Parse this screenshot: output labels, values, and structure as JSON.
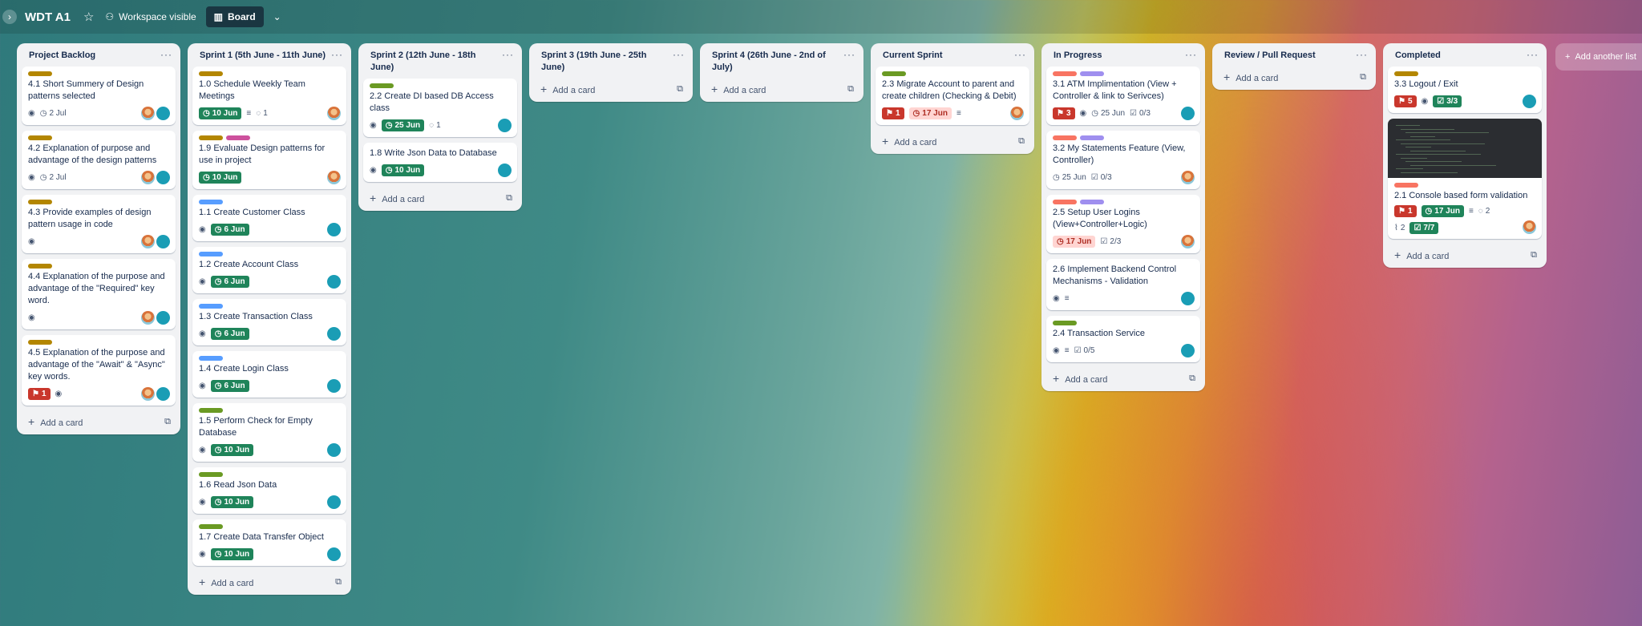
{
  "topbar": {
    "title": "WDT A1",
    "visibility": "Workspace visible",
    "view": "Board"
  },
  "colors": {
    "yellow": "#b38600",
    "orange": "#f87462",
    "purple": "#9f8fef",
    "green": "#5b7f24",
    "blue": "#579dff",
    "pink": "#cd519d",
    "lime": "#6a9a23"
  },
  "add_card": "Add a card",
  "add_list": "Add another list",
  "lists": [
    {
      "title": "Project Backlog",
      "cards": [
        {
          "labels": [
            "yellow"
          ],
          "title": "4.1 Short Summery of Design patterns selected",
          "eye": true,
          "date": "2 Jul",
          "avatars": [
            "ph",
            "kb"
          ]
        },
        {
          "labels": [
            "yellow"
          ],
          "title": "4.2 Explanation of purpose and advantage of the design patterns",
          "eye": true,
          "date": "2 Jul",
          "avatars": [
            "ph",
            "kb"
          ]
        },
        {
          "labels": [
            "yellow"
          ],
          "title": "4.3 Provide examples of design pattern usage in code",
          "eye": true,
          "avatars": [
            "ph",
            "kb"
          ]
        },
        {
          "labels": [
            "yellow"
          ],
          "title": "4.4 Explanation of the purpose and advantage of the \"Required\" key word.",
          "eye": true,
          "avatars": [
            "ph",
            "kb"
          ]
        },
        {
          "labels": [
            "yellow"
          ],
          "title": "4.5 Explanation of the purpose and advantage of the \"Await\" & \"Async\" key words.",
          "badge": "1",
          "eye": true,
          "avatars": [
            "ph",
            "kb"
          ]
        }
      ]
    },
    {
      "title": "Sprint 1 (5th June - 11th June)",
      "cards": [
        {
          "labels": [
            "yellow"
          ],
          "title": "1.0 Schedule Weekly Team Meetings",
          "due": "10 Jun",
          "desc": true,
          "comments": "1",
          "avatars": [
            "ph"
          ]
        },
        {
          "labels": [
            "yellow",
            "pink"
          ],
          "title": "1.9 Evaluate Design patterns for use in project",
          "due": "10 Jun",
          "avatars": [
            "ph"
          ]
        },
        {
          "labels": [
            "blue"
          ],
          "title": "1.1 Create Customer Class",
          "eye": true,
          "due": "6 Jun",
          "avatars": [
            "kb"
          ]
        },
        {
          "labels": [
            "blue"
          ],
          "title": "1.2 Create Account Class",
          "eye": true,
          "due": "6 Jun",
          "avatars": [
            "kb"
          ]
        },
        {
          "labels": [
            "blue"
          ],
          "title": "1.3 Create Transaction Class",
          "eye": true,
          "due": "6 Jun",
          "avatars": [
            "kb"
          ]
        },
        {
          "labels": [
            "blue"
          ],
          "title": "1.4 Create Login Class",
          "eye": true,
          "due": "6 Jun",
          "avatars": [
            "kb"
          ]
        },
        {
          "labels": [
            "lime"
          ],
          "title": "1.5 Perform Check for Empty Database",
          "eye": true,
          "due": "10 Jun",
          "avatars": [
            "kb"
          ]
        },
        {
          "labels": [
            "lime"
          ],
          "title": "1.6 Read Json Data",
          "eye": true,
          "due": "10 Jun",
          "avatars": [
            "kb"
          ]
        },
        {
          "labels": [
            "lime"
          ],
          "title": "1.7 Create Data Transfer Object",
          "eye": true,
          "due": "10 Jun",
          "avatars": [
            "kb"
          ]
        }
      ]
    },
    {
      "title": "Sprint 2 (12th June - 18th June)",
      "cards": [
        {
          "labels": [
            "lime"
          ],
          "title": "2.2 Create DI based DB Access class",
          "eye": true,
          "due": "25 Jun",
          "comments": "1",
          "avatars": [
            "kb"
          ]
        },
        {
          "labels": [],
          "title": "1.8 Write Json Data to Database",
          "eye": true,
          "due": "10 Jun",
          "avatars": [
            "kb"
          ]
        }
      ]
    },
    {
      "title": "Sprint 3 (19th June - 25th June)",
      "cards": []
    },
    {
      "title": "Sprint 4 (26th June - 2nd of July)",
      "cards": []
    },
    {
      "title": "Current Sprint",
      "cards": [
        {
          "labels": [
            "lime"
          ],
          "title": "2.3 Migrate Account to parent and create children (Checking & Debit)",
          "badge": "1",
          "overdue": "17 Jun",
          "desc": true,
          "avatars": [
            "ph"
          ]
        }
      ]
    },
    {
      "title": "In Progress",
      "cards": [
        {
          "labels": [
            "orange",
            "purple"
          ],
          "title": "3.1 ATM Implimentation (View + Controller & link to Serivces)",
          "badge": "3",
          "eye": true,
          "date": "25 Jun",
          "check": "0/3",
          "avatars": [
            "kb"
          ]
        },
        {
          "labels": [
            "orange",
            "purple"
          ],
          "title": "3.2 My Statements Feature (View, Controller)",
          "date": "25 Jun",
          "check": "0/3",
          "avatars": [
            "ph"
          ]
        },
        {
          "labels": [
            "orange",
            "purple"
          ],
          "title": "2.5 Setup User Logins (View+Controller+Logic)",
          "overdue": "17 Jun",
          "check": "2/3",
          "avatars": [
            "ph"
          ]
        },
        {
          "labels": [],
          "title": "2.6 Implement Backend Control Mechanisms - Validation",
          "eye": true,
          "desc": true,
          "avatars": [
            "kb"
          ]
        },
        {
          "labels": [
            "lime"
          ],
          "title": "2.4 Transaction Service",
          "eye": true,
          "desc": true,
          "check": "0/5",
          "avatars": [
            "kb"
          ]
        }
      ]
    },
    {
      "title": "Review / Pull Request",
      "cards": []
    },
    {
      "title": "Completed",
      "cards": [
        {
          "labels": [
            "yellow"
          ],
          "title": "3.3 Logout / Exit",
          "badge": "5",
          "eye": true,
          "checkdone": "3/3",
          "avatars": [
            "kb"
          ]
        },
        {
          "cover": true,
          "labels": [
            "orange"
          ],
          "title": "2.1 Console based form validation",
          "badge": "1",
          "due": "17 Jun",
          "desc": true,
          "comments": "2",
          "attach": "2",
          "checkdone": "7/7",
          "avatars": [
            "ph"
          ]
        }
      ]
    }
  ]
}
